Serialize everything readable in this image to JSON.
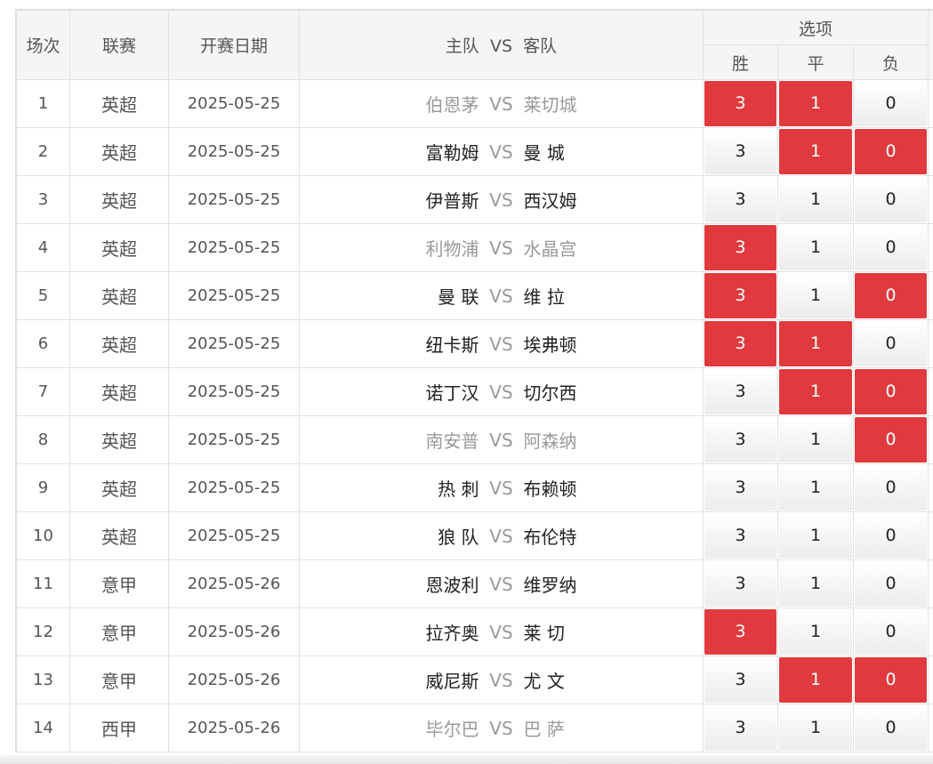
{
  "headers": {
    "no": "场次",
    "league": "联赛",
    "date": "开赛日期",
    "home": "主队",
    "vs": "VS",
    "away": "客队",
    "options": "选项",
    "win": "胜",
    "draw": "平",
    "lose": "负"
  },
  "colors": {
    "selected": "#e03a3e",
    "dim_text": "#999999"
  },
  "rows": [
    {
      "no": "1",
      "league": "英超",
      "date": "2025-05-25",
      "home": "伯恩茅",
      "away": "莱切城",
      "dim": true,
      "win": "3",
      "draw": "1",
      "lose": "0",
      "sel": [
        true,
        true,
        false
      ]
    },
    {
      "no": "2",
      "league": "英超",
      "date": "2025-05-25",
      "home": "富勒姆",
      "away": "曼 城",
      "dim": false,
      "win": "3",
      "draw": "1",
      "lose": "0",
      "sel": [
        false,
        true,
        true
      ]
    },
    {
      "no": "3",
      "league": "英超",
      "date": "2025-05-25",
      "home": "伊普斯",
      "away": "西汉姆",
      "dim": false,
      "win": "3",
      "draw": "1",
      "lose": "0",
      "sel": [
        false,
        false,
        false
      ]
    },
    {
      "no": "4",
      "league": "英超",
      "date": "2025-05-25",
      "home": "利物浦",
      "away": "水晶宫",
      "dim": true,
      "win": "3",
      "draw": "1",
      "lose": "0",
      "sel": [
        true,
        false,
        false
      ]
    },
    {
      "no": "5",
      "league": "英超",
      "date": "2025-05-25",
      "home": "曼 联",
      "away": "维 拉",
      "dim": false,
      "win": "3",
      "draw": "1",
      "lose": "0",
      "sel": [
        true,
        false,
        true
      ]
    },
    {
      "no": "6",
      "league": "英超",
      "date": "2025-05-25",
      "home": "纽卡斯",
      "away": "埃弗顿",
      "dim": false,
      "win": "3",
      "draw": "1",
      "lose": "0",
      "sel": [
        true,
        true,
        false
      ]
    },
    {
      "no": "7",
      "league": "英超",
      "date": "2025-05-25",
      "home": "诺丁汉",
      "away": "切尔西",
      "dim": false,
      "win": "3",
      "draw": "1",
      "lose": "0",
      "sel": [
        false,
        true,
        true
      ]
    },
    {
      "no": "8",
      "league": "英超",
      "date": "2025-05-25",
      "home": "南安普",
      "away": "阿森纳",
      "dim": true,
      "win": "3",
      "draw": "1",
      "lose": "0",
      "sel": [
        false,
        false,
        true
      ]
    },
    {
      "no": "9",
      "league": "英超",
      "date": "2025-05-25",
      "home": "热 刺",
      "away": "布赖顿",
      "dim": false,
      "win": "3",
      "draw": "1",
      "lose": "0",
      "sel": [
        false,
        false,
        false
      ]
    },
    {
      "no": "10",
      "league": "英超",
      "date": "2025-05-25",
      "home": "狼 队",
      "away": "布伦特",
      "dim": false,
      "win": "3",
      "draw": "1",
      "lose": "0",
      "sel": [
        false,
        false,
        false
      ]
    },
    {
      "no": "11",
      "league": "意甲",
      "date": "2025-05-26",
      "home": "恩波利",
      "away": "维罗纳",
      "dim": false,
      "win": "3",
      "draw": "1",
      "lose": "0",
      "sel": [
        false,
        false,
        false
      ]
    },
    {
      "no": "12",
      "league": "意甲",
      "date": "2025-05-26",
      "home": "拉齐奥",
      "away": "莱 切",
      "dim": false,
      "win": "3",
      "draw": "1",
      "lose": "0",
      "sel": [
        true,
        false,
        false
      ]
    },
    {
      "no": "13",
      "league": "意甲",
      "date": "2025-05-26",
      "home": "威尼斯",
      "away": "尤 文",
      "dim": false,
      "win": "3",
      "draw": "1",
      "lose": "0",
      "sel": [
        false,
        true,
        true
      ]
    },
    {
      "no": "14",
      "league": "西甲",
      "date": "2025-05-26",
      "home": "毕尔巴",
      "away": "巴 萨",
      "dim": true,
      "win": "3",
      "draw": "1",
      "lose": "0",
      "sel": [
        false,
        false,
        false
      ]
    }
  ]
}
